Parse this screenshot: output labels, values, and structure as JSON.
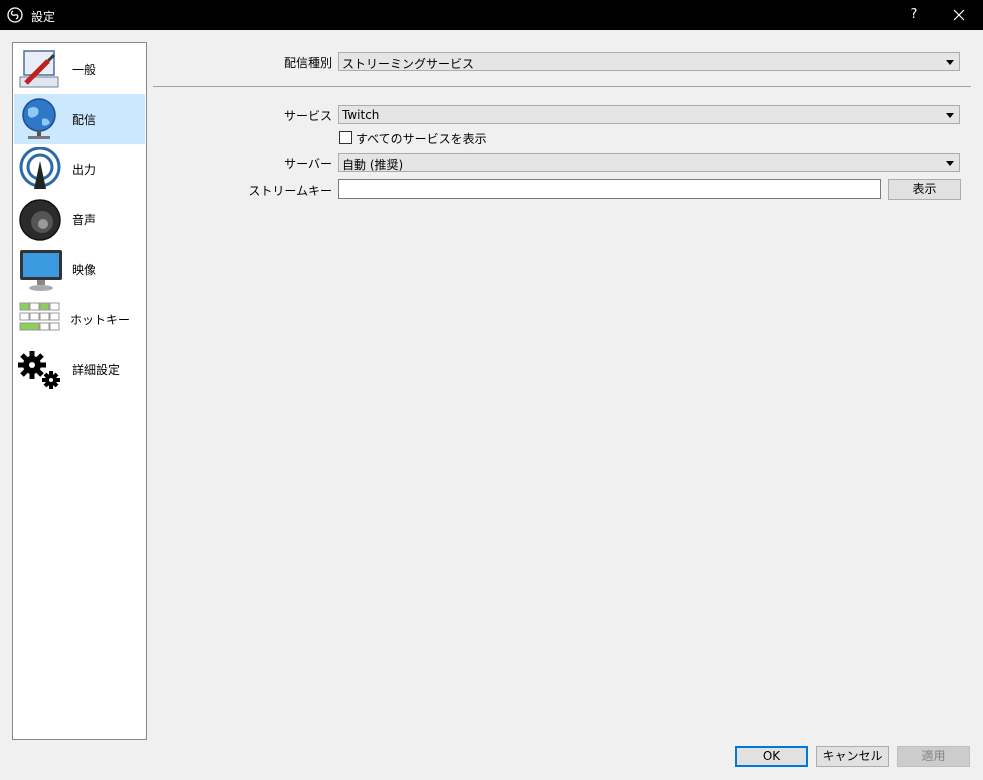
{
  "window": {
    "title": "設定",
    "help": "?"
  },
  "sidebar": {
    "items": [
      {
        "label": "一般",
        "icon": "general-icon"
      },
      {
        "label": "配信",
        "icon": "stream-globe-icon"
      },
      {
        "label": "出力",
        "icon": "output-icon"
      },
      {
        "label": "音声",
        "icon": "speaker-icon"
      },
      {
        "label": "映像",
        "icon": "monitor-icon"
      },
      {
        "label": "ホットキー",
        "icon": "keyboard-icon"
      },
      {
        "label": "詳細設定",
        "icon": "gears-icon"
      }
    ],
    "selected": "配信"
  },
  "stream": {
    "type_label": "配信種別",
    "type_value": "ストリーミングサービス",
    "service_label": "サービス",
    "service_value": "Twitch",
    "show_all_label": "すべてのサービスを表示",
    "show_all_checked": false,
    "server_label": "サーバー",
    "server_value": "自動 (推奨)",
    "key_label": "ストリームキー",
    "key_value": "",
    "show_button": "表示"
  },
  "footer": {
    "ok": "OK",
    "cancel": "キャンセル",
    "apply": "適用"
  },
  "colors": {
    "titlebar": "#000000",
    "selection": "#cce8ff",
    "default_button_border": "#0078d7"
  }
}
